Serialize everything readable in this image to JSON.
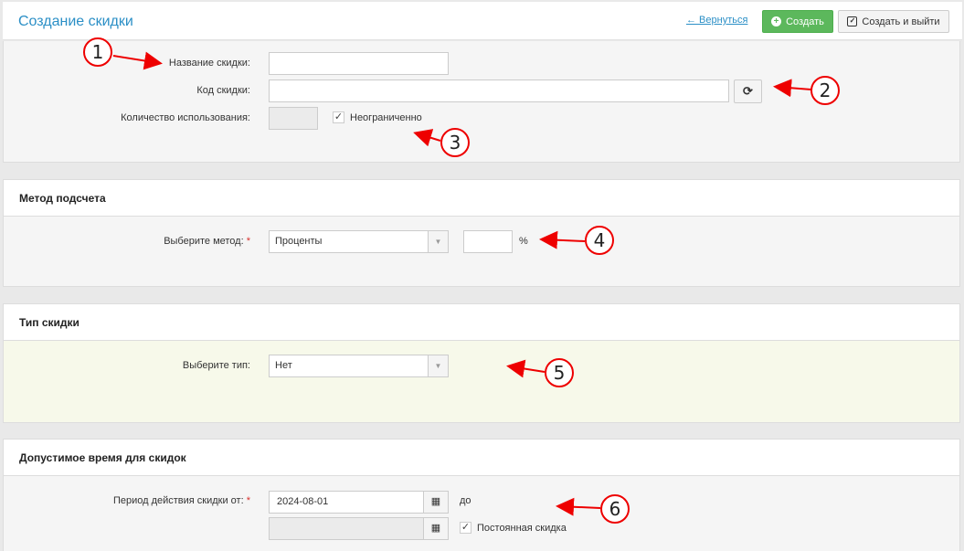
{
  "header": {
    "title": "Создание скидки",
    "back_label": "← Вернуться",
    "create_label": "Создать",
    "create_exit_label": "Создать и выйти"
  },
  "general": {
    "name_label": "Название скидки:",
    "name_value": "",
    "code_label": "Код скидки:",
    "code_value": "",
    "usage_label": "Количество использования:",
    "usage_value": "",
    "unlimited_label": "Неограниченно",
    "unlimited_checked": true
  },
  "method": {
    "heading": "Метод подсчета",
    "select_label": "Выберите метод:",
    "required_mark": "*",
    "selected": "Проценты",
    "amount_value": "",
    "unit": "%"
  },
  "type": {
    "heading": "Тип скидки",
    "select_label": "Выберите тип:",
    "selected": "Нет"
  },
  "time": {
    "heading": "Допустимое время для скидок",
    "period_label": "Период действия скидки от:",
    "required_mark": "*",
    "from_value": "2024-08-01",
    "to_label": "до",
    "to_value": "",
    "permanent_label": "Постоянная скидка",
    "permanent_checked": true
  },
  "annotations": [
    "1",
    "2",
    "3",
    "4",
    "5",
    "6"
  ],
  "colors": {
    "accent": "#2b8fc6",
    "create_button": "#5cb85c",
    "annotation": "#e00000",
    "type_panel_bg": "#f7f9ea"
  },
  "icons": {
    "back": "arrow-left-icon",
    "create": "plus-circle-icon",
    "create_exit": "check-square-icon",
    "refresh": "refresh-icon",
    "calendar": "calendar-icon",
    "dropdown": "caret-down-icon",
    "checkbox": "check-icon"
  }
}
